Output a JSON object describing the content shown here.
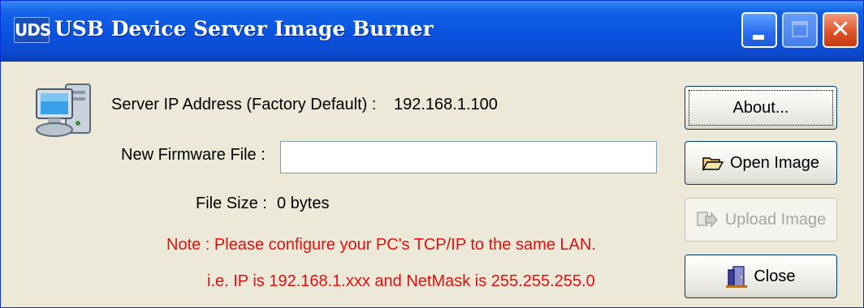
{
  "window": {
    "icon_text": "UDS",
    "title": "USB Device Server Image Burner"
  },
  "main": {
    "server_ip_label": "Server IP Address (Factory Default) :",
    "server_ip_value": "192.168.1.100",
    "firmware_label": "New Firmware File :",
    "firmware_value": "",
    "file_size_label": "File Size :",
    "file_size_value": "0 bytes",
    "note_line1": "Note : Please configure your PC's TCP/IP to the same LAN.",
    "note_line2": "i.e. IP is 192.168.1.xxx and NetMask is 255.255.255.0"
  },
  "buttons": {
    "about": "About...",
    "open_image": "Open Image",
    "upload_image": "Upload Image",
    "close": "Close"
  },
  "colors": {
    "titlebar": "#0a52e0",
    "note_text": "#e11010",
    "dialog_bg": "#ece9d8"
  }
}
